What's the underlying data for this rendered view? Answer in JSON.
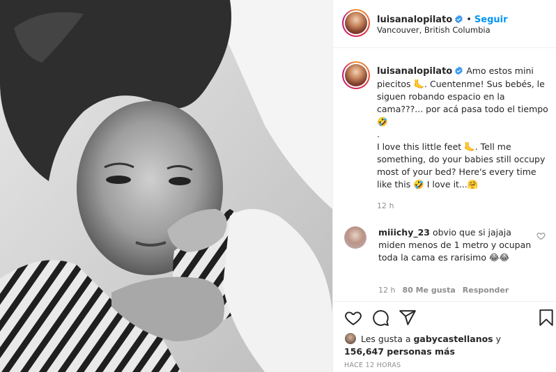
{
  "post": {
    "photo": {
      "icon": "selfie-photo"
    },
    "header": {
      "username": "luisanalopilato",
      "verified_icon": "verified-badge-icon",
      "separator": "•",
      "follow_label": "Seguir",
      "location": "Vancouver, British Columbia"
    },
    "caption": {
      "username": "luisanalopilato",
      "text": "Amo estos mini piecitos 🦶. Cuentenme! Sus bebés, le siguen robando espacio en la cama???... por acá pasa todo el tiempo 🤣\n.\nI love this little feet 🦶. Tell me something, do your babies still occupy most of your bed? Here's every time like this 🤣 I love it...🤗",
      "time": "12 h"
    },
    "comment": {
      "username": "miiichy_23",
      "text": "obvio que si jajaja miden menos de 1 metro y ocupan toda la cama es rarisimo 😂😂",
      "time": "12 h",
      "likes": "80 Me gusta",
      "reply": "Responder"
    },
    "actions": {
      "like_icon": "heart-icon",
      "comment_icon": "comment-icon",
      "share_icon": "share-icon",
      "save_icon": "bookmark-icon"
    },
    "likes": {
      "prefix": "Les gusta a ",
      "user": "gabycastellanos",
      "middle": " y",
      "count": "156,647 personas más"
    },
    "posted": "HACE 12 HORAS",
    "colors": {
      "follow": "#0095f6",
      "secondary": "#8e8e8e",
      "border": "#efefef"
    }
  }
}
